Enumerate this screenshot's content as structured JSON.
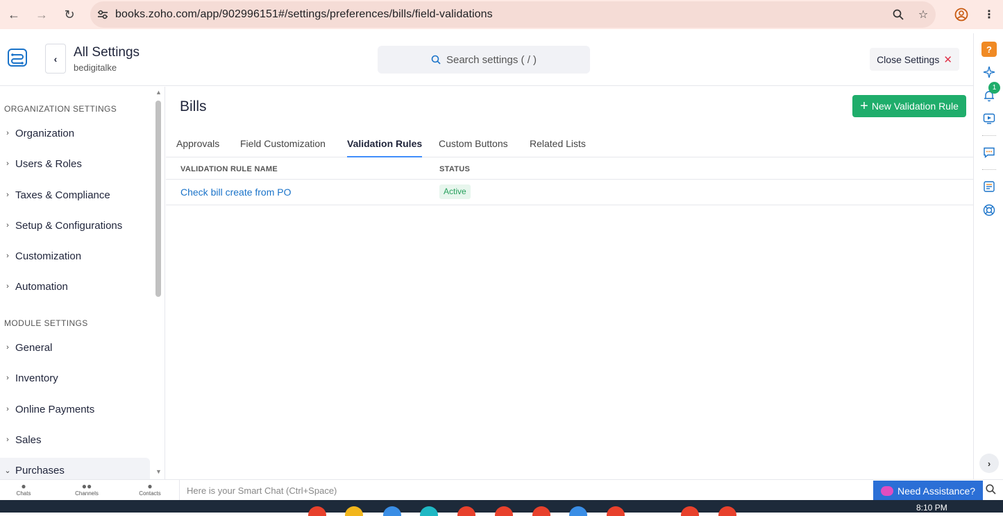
{
  "browser": {
    "back_icon": "←",
    "forward_icon": "→",
    "reload_icon": "↻",
    "url": "books.zoho.com/app/902996151#/settings/preferences/bills/field-validations",
    "zoom_icon": "🔍",
    "star_icon": "☆",
    "profile_icon": "◉",
    "menu_icon": "⋮"
  },
  "header": {
    "back_icon": "‹",
    "title": "All Settings",
    "org_name": "bedigitalke",
    "search_placeholder": "Search settings ( / )",
    "search_icon": "⚲",
    "close_label": "Close Settings",
    "close_icon": "✕"
  },
  "sidebar": {
    "org_section": "ORGANIZATION SETTINGS",
    "org_items": [
      {
        "label": "Organization"
      },
      {
        "label": "Users & Roles"
      },
      {
        "label": "Taxes & Compliance"
      },
      {
        "label": "Setup & Configurations"
      },
      {
        "label": "Customization"
      },
      {
        "label": "Automation"
      }
    ],
    "module_section": "MODULE SETTINGS",
    "module_items": [
      {
        "label": "General"
      },
      {
        "label": "Inventory"
      },
      {
        "label": "Online Payments"
      },
      {
        "label": "Sales"
      },
      {
        "label": "Purchases"
      }
    ]
  },
  "main": {
    "title": "Bills",
    "new_button": "New Validation Rule",
    "new_button_icon": "+",
    "tabs": [
      {
        "label": "Approvals"
      },
      {
        "label": "Field Customization"
      },
      {
        "label": "Validation Rules"
      },
      {
        "label": "Custom Buttons"
      },
      {
        "label": "Related Lists"
      }
    ],
    "active_tab": "Validation Rules",
    "columns": {
      "name": "VALIDATION RULE NAME",
      "status": "STATUS"
    },
    "rows": [
      {
        "name": "Check bill create from PO",
        "status": "Active"
      }
    ]
  },
  "rail": {
    "help_icon": "?",
    "notifications_count": "1"
  },
  "bottom": {
    "chats": "Chats",
    "channels": "Channels",
    "contacts": "Contacts",
    "smart_chat_placeholder": "Here is your Smart Chat (Ctrl+Space)",
    "assist_label": "Need Assistance?",
    "time": "8:10 PM"
  },
  "colors": {
    "accent_green": "#1fad6b",
    "link_blue": "#1a73c9",
    "browser_bar": "#fde9e4",
    "assist_blue": "#2b6fd6"
  }
}
